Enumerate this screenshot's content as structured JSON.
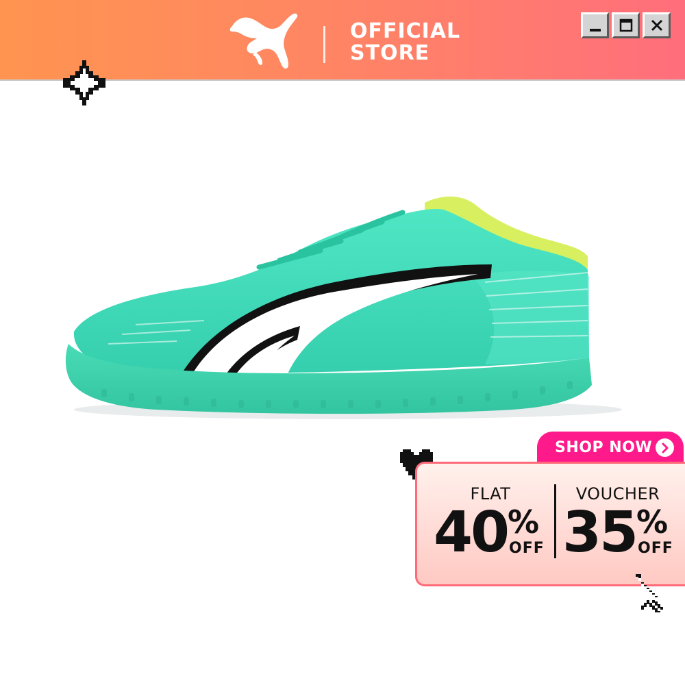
{
  "header": {
    "store_line1": "OFFICIAL",
    "store_line2": "STORE",
    "background_gradient": [
      "#ff9450",
      "#ff6e7c"
    ],
    "logo_icon": "puma-cat-logo-icon"
  },
  "window_controls": {
    "minimize_icon": "minimize-icon",
    "maximize_icon": "maximize-icon",
    "close_icon": "close-icon"
  },
  "decor": {
    "sparkle_icon": "sparkle-icon",
    "heart_icon": "pixel-heart-icon",
    "cursor_icon": "pointer-cursor-icon"
  },
  "product": {
    "image": "turquoise-indoor-football-shoe",
    "colors": {
      "upper": "#3fdcb8",
      "sole": "#43d8b2",
      "collar": "#d8f060",
      "stripe": "#ffffff",
      "outline": "#111111"
    }
  },
  "promo": {
    "cta_label": "SHOP NOW",
    "cta_icon": "chevron-right-circle-icon",
    "cta_color": "#ff1a8c",
    "left": {
      "caption": "FLAT",
      "value": "40",
      "percent": "%",
      "suffix": "OFF"
    },
    "right": {
      "caption": "VOUCHER",
      "value": "35",
      "percent": "%",
      "suffix": "OFF"
    }
  }
}
